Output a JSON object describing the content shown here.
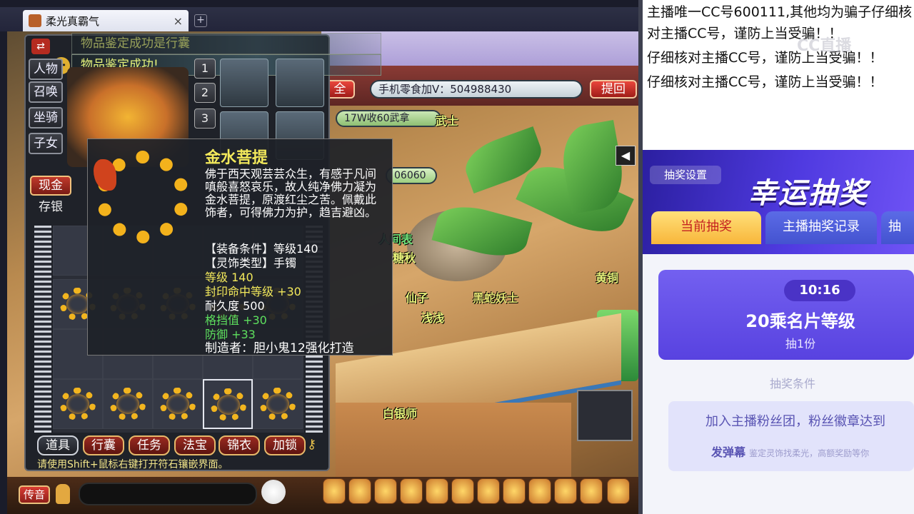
{
  "browser": {
    "tab_title": "柔光真霸气",
    "close_label": "×",
    "new_tab_label": "+"
  },
  "inventory": {
    "toasts": [
      "物品鉴定成功!",
      "物品鉴定成功!"
    ],
    "toast_ghost": "物品鉴定成功是行囊",
    "side_buttons": [
      "人物",
      "召唤",
      "坐骑",
      "子女"
    ],
    "slot_numbers": [
      "1",
      "2",
      "3"
    ],
    "currency_cash": "现金",
    "currency_bank": "存银",
    "bottom_tabs": [
      "道具",
      "行囊",
      "任务",
      "法宝",
      "锦衣",
      "加锁"
    ],
    "hint": "请使用Shift+鼠标右键打开符石镶嵌界面。"
  },
  "tooltip": {
    "name": "金水菩提",
    "description": "佛于西天观芸芸众生，有感于凡间嗔般喜怒哀乐，故人纯净佛力凝为金水菩提，原渡红尘之苦。佩戴此饰者，可得佛力为护，趋吉避凶。",
    "req_label": "【装备条件】等级140",
    "type_label": "【灵饰类型】手镯",
    "level": "等级 140",
    "seal_hit": "封印命中等级 +30",
    "durability": "耐久度 500",
    "block": "格挡值 +30",
    "defense": "防御 +33",
    "maker": "制造者：胆小鬼12强化打造"
  },
  "hud": {
    "all_label": "全",
    "phone_snack": "手机零食加V：504988430",
    "withdraw": "提回",
    "buy_tag": "17W收60武拿",
    "number_tag": "06060",
    "npcs": [
      "武士",
      "人间表",
      "糖秋",
      "仙子",
      "浅浅",
      "黄铜",
      "黑蛇妖士",
      "白银师"
    ]
  },
  "chat": {
    "speaker_label": "传音"
  },
  "right_panel": {
    "messages": [
      "主播唯一CC号600111,其他均为骗子仔细核对主播CC号，谨防上当受骗！！",
      "仔细核对主播CC号，谨防上当受骗！！",
      "仔细核对主播CC号，谨防上当受骗！！"
    ],
    "watermark": "CC直播",
    "lottery_settings": "抽奖设置",
    "lottery_banner": "幸运抽奖",
    "tabs": [
      "当前抽奖",
      "主播抽奖记录",
      "抽"
    ],
    "timer": "10:16",
    "prize_title": "20乘名片等级",
    "prize_count": "抽1份",
    "condition_header": "抽奖条件",
    "condition_text": "加入主播粉丝团，粉丝徽章达到",
    "condition_sub": "发弹幕",
    "condition_sub_detail": "鉴定灵饰找柔光，高额奖励等你"
  }
}
